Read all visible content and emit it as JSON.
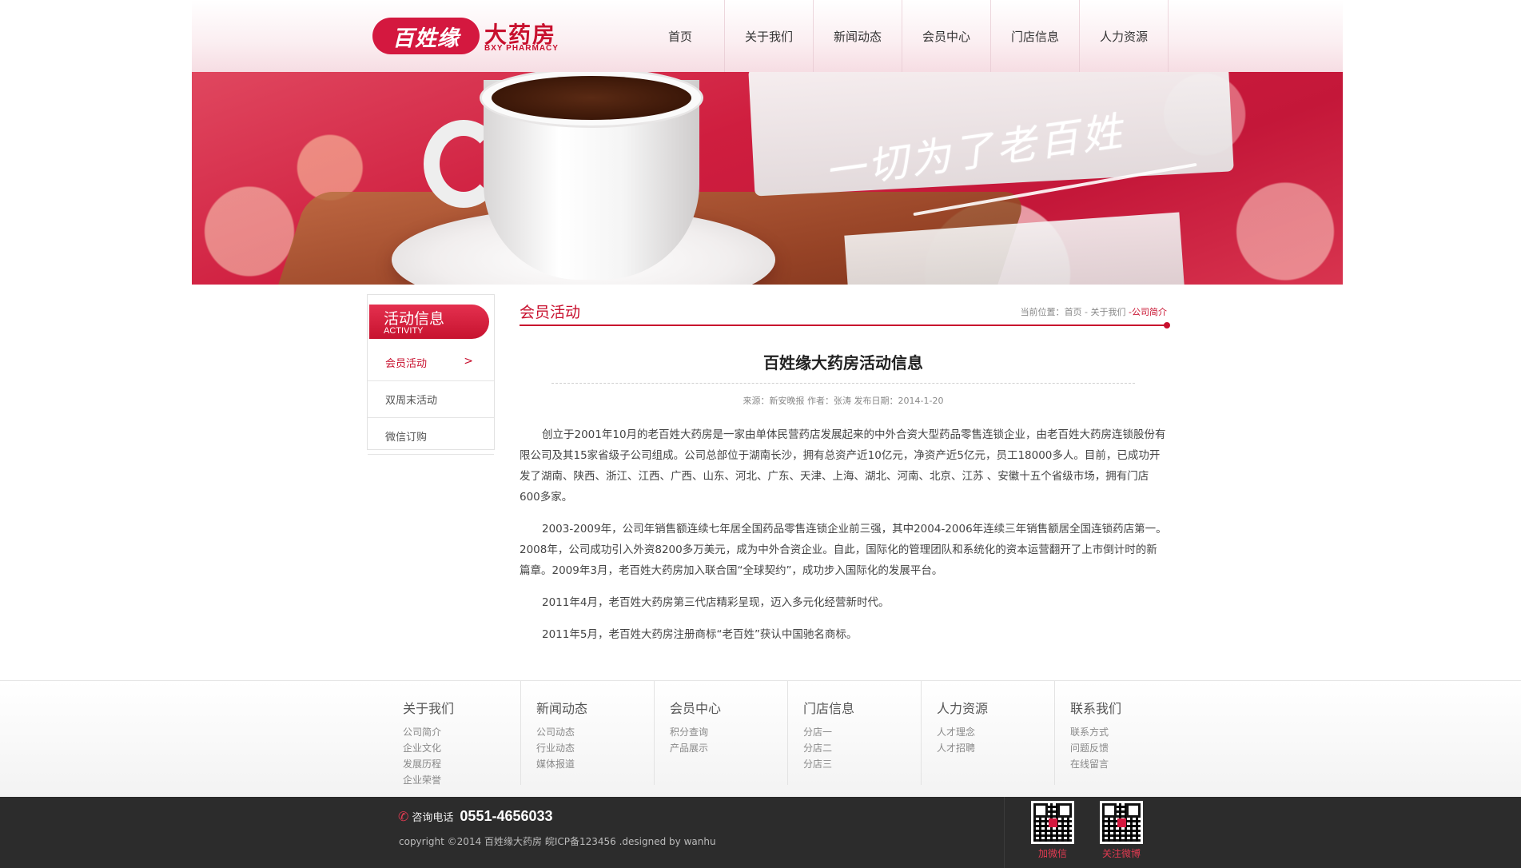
{
  "header": {
    "logo": {
      "brand": "百姓缘",
      "main": "大药房",
      "sub": "BXY PHARMACY"
    },
    "nav": [
      "首页",
      "关于我们",
      "新闻动态",
      "会员中心",
      "门店信息",
      "人力资源"
    ]
  },
  "banner": {
    "slogan": "一切为了老百姓"
  },
  "sidebar": {
    "title": "活动信息",
    "subtitle": "ACTIVITY",
    "items": [
      {
        "label": "会员活动",
        "active": true
      },
      {
        "label": "双周末活动",
        "active": false
      },
      {
        "label": "微信订购",
        "active": false
      }
    ],
    "active_arrow": ">"
  },
  "main": {
    "section_title": "会员活动",
    "breadcrumb": {
      "prefix": "当前位置：",
      "home": "首页",
      "sep1": " - ",
      "parent": "关于我们",
      "sep2": " -",
      "current": "公司简介"
    },
    "article": {
      "title": "百姓缘大药房活动信息",
      "meta": "来源：新安晚报 作者：张涛 发布日期：2014-1-20",
      "paragraphs": [
        "创立于2001年10月的老百姓大药房是一家由单体民营药店发展起来的中外合资大型药品零售连锁企业，由老百姓大药房连锁股份有限公司及其15家省级子公司组成。公司总部位于湖南长沙，拥有总资产近10亿元，净资产近5亿元，员工18000多人。目前，已成功开发了湖南、陕西、浙江、江西、广西、山东、河北、广东、天津、上海、湖北、河南、北京、江苏 、安徽十五个省级市场，拥有门店600多家。",
        "2003-2009年，公司年销售额连续七年居全国药品零售连锁企业前三强，其中2004-2006年连续三年销售额居全国连锁药店第一。2008年，公司成功引入外资8200多万美元，成为中外合资企业。自此，国际化的管理团队和系统化的资本运营翻开了上市倒计时的新篇章。2009年3月，老百姓大药房加入联合国“全球契约”，成功步入国际化的发展平台。",
        "2011年4月，老百姓大药房第三代店精彩呈现，迈入多元化经营新时代。",
        "2011年5月，老百姓大药房注册商标“老百姓”获认中国驰名商标。"
      ]
    }
  },
  "footer": {
    "columns": [
      {
        "title": "关于我们",
        "links": [
          "公司简介",
          "企业文化",
          "发展历程",
          "企业荣誉"
        ]
      },
      {
        "title": "新闻动态",
        "links": [
          "公司动态",
          "行业动态",
          "媒体报道"
        ]
      },
      {
        "title": "会员中心",
        "links": [
          "积分查询",
          "产品展示"
        ]
      },
      {
        "title": "门店信息",
        "links": [
          "分店一",
          "分店二",
          "分店三"
        ]
      },
      {
        "title": "人力资源",
        "links": [
          "人才理念",
          "人才招聘"
        ]
      },
      {
        "title": "联系我们",
        "links": [
          "联系方式",
          "问题反馈",
          "在线留言"
        ]
      }
    ],
    "hotline_label": "咨询电话",
    "hotline_number": "0551-4656033",
    "copyright": "copyright ©2014 百姓缘大药房 皖ICP备123456 .designed by wanhu",
    "qr": [
      {
        "label": "加微信"
      },
      {
        "label": "关注微博"
      }
    ]
  },
  "colors": {
    "accent": "#c8102e",
    "footer_bg": "#2c2c2c"
  }
}
